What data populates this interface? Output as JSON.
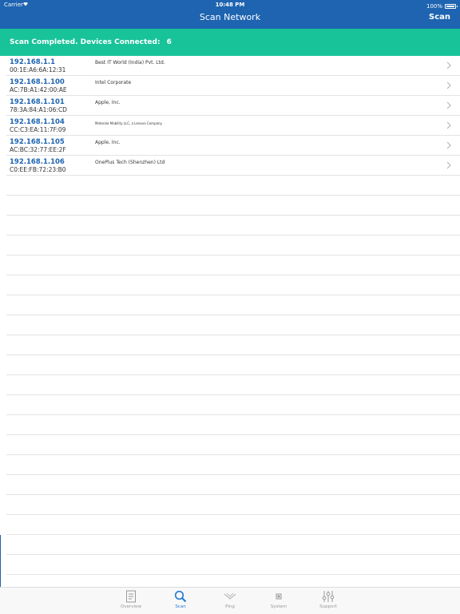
{
  "status_bar": {
    "carrier": "Carrier",
    "time": "10:48 PM",
    "battery": "100%"
  },
  "nav": {
    "title": "Scan Network",
    "scan_button": "Scan"
  },
  "banner": {
    "text": "Scan Completed. Devices Connected:",
    "count": "6"
  },
  "devices": [
    {
      "ip": "192.168.1.1",
      "mac": "00:1E:A6:6A:12:31",
      "vendor": "Best IT World (India) Pvt. Ltd."
    },
    {
      "ip": "192.168.1.100",
      "mac": "AC:7B:A1:42:00:AE",
      "vendor": "Intel Corporate"
    },
    {
      "ip": "192.168.1.101",
      "mac": "78:3A:84:A1:06:CD",
      "vendor": "Apple, Inc."
    },
    {
      "ip": "192.168.1.104",
      "mac": "CC:C3:EA:11:7F:09",
      "vendor": "Motorola Mobility LLC, a Lenovo Company"
    },
    {
      "ip": "192.168.1.105",
      "mac": "AC:BC:32:77:EE:2F",
      "vendor": "Apple, Inc."
    },
    {
      "ip": "192.168.1.106",
      "mac": "C0:EE:FB:72:23:B0",
      "vendor": "OnePlus Tech (Shenzhen) Ltd"
    }
  ],
  "tabs": [
    {
      "label": "Overview",
      "icon": "document-icon"
    },
    {
      "label": "Scan",
      "icon": "magnifier-icon"
    },
    {
      "label": "Ping",
      "icon": "ping-icon"
    },
    {
      "label": "System",
      "icon": "chip-icon"
    },
    {
      "label": "Support",
      "icon": "sliders-icon"
    }
  ],
  "colors": {
    "nav": "#1e64b0",
    "banner": "#19c39a",
    "active_tab": "#1e7bd0"
  }
}
